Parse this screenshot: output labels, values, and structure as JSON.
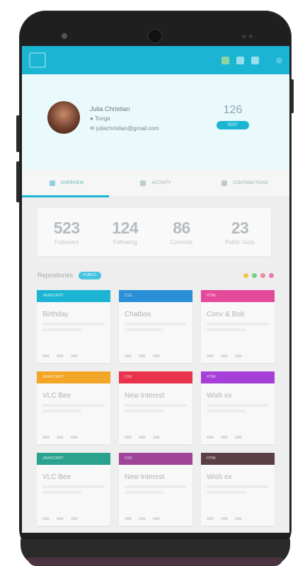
{
  "profile": {
    "name": "Julia Christian",
    "location": "Tonga",
    "email": "juliachristian@gmail.com",
    "count": "126",
    "button_label": "EDIT"
  },
  "tabs": [
    {
      "label": "OVERVIEW"
    },
    {
      "label": "ACTIVITY"
    },
    {
      "label": "CONTRIBUTIONS"
    }
  ],
  "stats": [
    {
      "value": "523",
      "label": "Followers"
    },
    {
      "value": "124",
      "label": "Following"
    },
    {
      "value": "86",
      "label": "Commits"
    },
    {
      "value": "23",
      "label": "Public Gists"
    }
  ],
  "repositories": {
    "title": "Repositories",
    "badge": "PUBLIC",
    "dot_colors": [
      "#f3c64a",
      "#7dcf88",
      "#f08aa5",
      "#e87ab8"
    ],
    "cards": [
      {
        "tag": "JAVASCRIPT",
        "title": "Birthday",
        "color": "#1bb5d3"
      },
      {
        "tag": "CSS",
        "title": "Chatbox",
        "color": "#2a8fd6"
      },
      {
        "tag": "HTML",
        "title": "Conv & Bob",
        "color": "#e54a9a"
      },
      {
        "tag": "JAVASCRIPT",
        "title": "VLC Bee",
        "color": "#f3a626"
      },
      {
        "tag": "CSS",
        "title": "New Interest",
        "color": "#e8334a"
      },
      {
        "tag": "HTML",
        "title": "Wish ex",
        "color": "#a63fd8"
      },
      {
        "tag": "JAVASCRIPT",
        "title": "VLC Bee",
        "color": "#2aa38e"
      },
      {
        "tag": "CSS",
        "title": "New Interest",
        "color": "#a0459a"
      },
      {
        "tag": "HTML",
        "title": "Wish ex",
        "color": "#5a4045"
      }
    ]
  }
}
